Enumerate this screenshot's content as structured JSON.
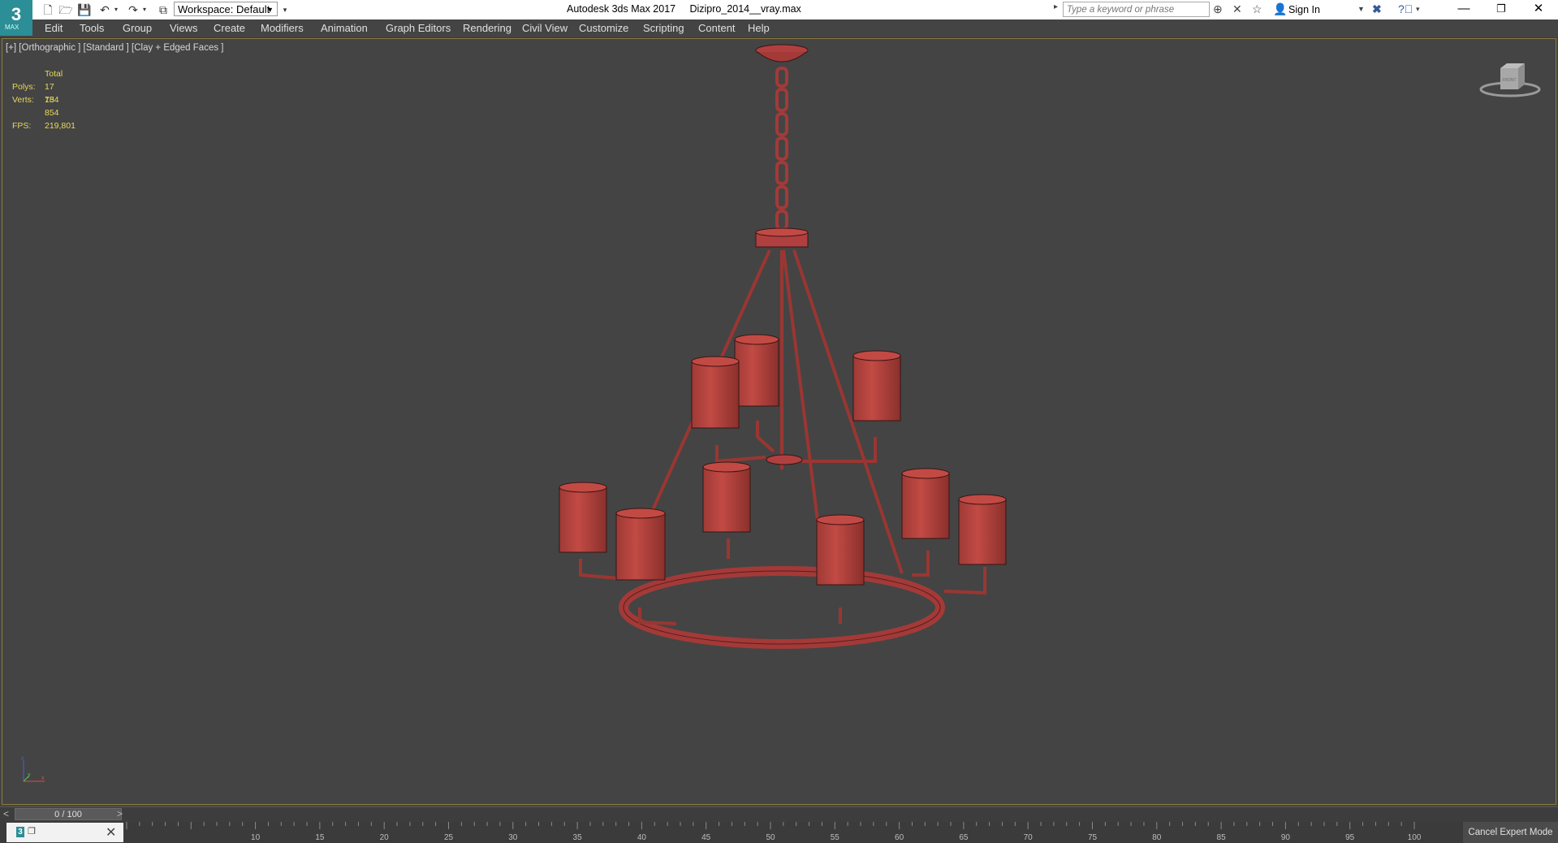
{
  "app": {
    "logo_text": "3",
    "logo_sub": "MAX",
    "title": "Autodesk 3ds Max 2017     Dizipro_2014__vray.max"
  },
  "quick_access": {
    "icons": [
      "new-file-icon",
      "open-file-icon",
      "save-icon",
      "undo-icon",
      "redo-icon",
      "project-folder-icon"
    ],
    "workspace_label": "Workspace: Default"
  },
  "search": {
    "placeholder": "Type a keyword or phrase"
  },
  "account": {
    "sign_in": "Sign In"
  },
  "menu": [
    "Edit",
    "Tools",
    "Group",
    "Views",
    "Create",
    "Modifiers",
    "Animation",
    "Graph Editors",
    "Rendering",
    "Civil View",
    "Customize",
    "Scripting",
    "Content",
    "Help"
  ],
  "viewport": {
    "label": "[+] [Orthographic ] [Standard ] [Clay + Edged Faces ]",
    "stats": {
      "header": "Total",
      "polys_label": "Polys:",
      "polys_value": "17 754",
      "verts_label": "Verts:",
      "verts_value": "18 854",
      "fps_label": "FPS:",
      "fps_value": "219,801"
    },
    "viewcube_label": "FRONT",
    "axis": {
      "x": "x",
      "y": "y",
      "z": "z"
    },
    "model_color": "#b04040",
    "model_edge_color": "#3a1414"
  },
  "timeslider": {
    "prev": "<",
    "next": ">",
    "position": "0 / 100",
    "frame_current": 0,
    "frame_total": 100
  },
  "trackbar": {
    "ticks": [
      "10",
      "15",
      "20",
      "25",
      "30",
      "35",
      "40",
      "45",
      "50",
      "55",
      "60",
      "65",
      "70",
      "75",
      "80",
      "85",
      "90",
      "95",
      "100"
    ],
    "expert_button": "Cancel Expert Mode"
  }
}
